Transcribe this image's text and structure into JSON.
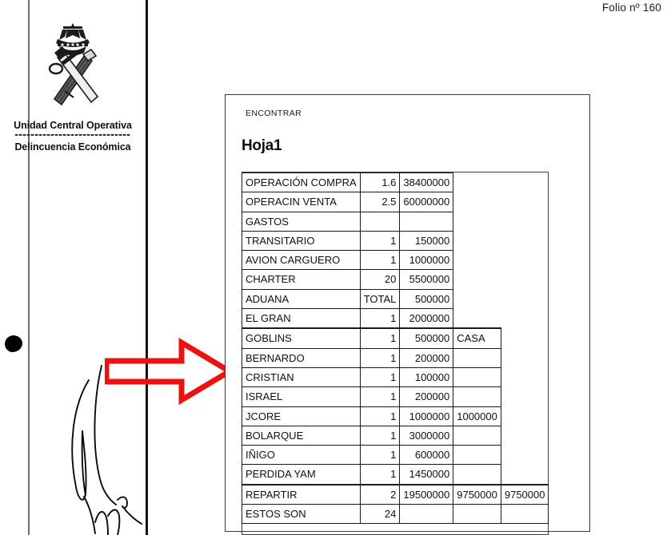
{
  "page": {
    "folio_label": "Folio nº 160"
  },
  "letterhead": {
    "emblem_name": "guardia-civil-emblem",
    "line1": "Unidad Central Operativa",
    "line2": "Delincuencia Económica"
  },
  "annotation": {
    "arrow_color": "#ee1111",
    "arrow_name": "red-pointer-arrow",
    "signature_name": "handwritten-rubric",
    "ink_blot_name": "ink-blot-mark"
  },
  "document": {
    "header_note": "ENCONTRAR",
    "title": "Hoja1",
    "table": {
      "rows": [
        {
          "label": "OPERACIÓN COMPRA",
          "qty": "1.6",
          "value": "38400000",
          "extra1": "",
          "extra2": ""
        },
        {
          "label": "OPERACIN VENTA",
          "qty": "2.5",
          "value": "60000000",
          "extra1": "",
          "extra2": ""
        },
        {
          "label": "GASTOS",
          "qty": "",
          "value": "",
          "extra1": "",
          "extra2": ""
        },
        {
          "label": "TRANSITARIO",
          "qty": "1",
          "value": "150000",
          "extra1": "",
          "extra2": ""
        },
        {
          "label": "AVION CARGUERO",
          "qty": "1",
          "value": "1000000",
          "extra1": "",
          "extra2": ""
        },
        {
          "label": "CHARTER",
          "qty": "20",
          "value": "5500000",
          "extra1": "",
          "extra2": ""
        },
        {
          "label": "ADUANA",
          "qty": "TOTAL",
          "value": "500000",
          "extra1": "",
          "extra2": ""
        },
        {
          "label": "EL GRAN",
          "qty": "1",
          "value": "2000000",
          "extra1": "",
          "extra2": ""
        },
        {
          "label": "GOBLINS",
          "qty": "1",
          "value": "500000",
          "extra1": "CASA",
          "extra2": ""
        },
        {
          "label": "BERNARDO",
          "qty": "1",
          "value": "200000",
          "extra1": "",
          "extra2": ""
        },
        {
          "label": "CRISTIAN",
          "qty": "1",
          "value": "100000",
          "extra1": "",
          "extra2": ""
        },
        {
          "label": "ISRAEL",
          "qty": "1",
          "value": "200000",
          "extra1": "",
          "extra2": ""
        },
        {
          "label": "JCORE",
          "qty": "1",
          "value": "1000000",
          "extra1": "1000000",
          "extra2": ""
        },
        {
          "label": "BOLARQUE",
          "qty": "1",
          "value": "3000000",
          "extra1": "",
          "extra2": ""
        },
        {
          "label": "IÑIGO",
          "qty": "1",
          "value": "600000",
          "extra1": "",
          "extra2": ""
        },
        {
          "label": "PERDIDA YAM",
          "qty": "1",
          "value": "1450000",
          "extra1": "",
          "extra2": ""
        },
        {
          "label": "REPARTIR",
          "qty": "2",
          "value": "19500000",
          "extra1": "9750000",
          "extra2": "9750000"
        },
        {
          "label": "ESTOS SON",
          "qty": "24",
          "value": "",
          "extra1": "",
          "extra2": ""
        }
      ]
    }
  }
}
